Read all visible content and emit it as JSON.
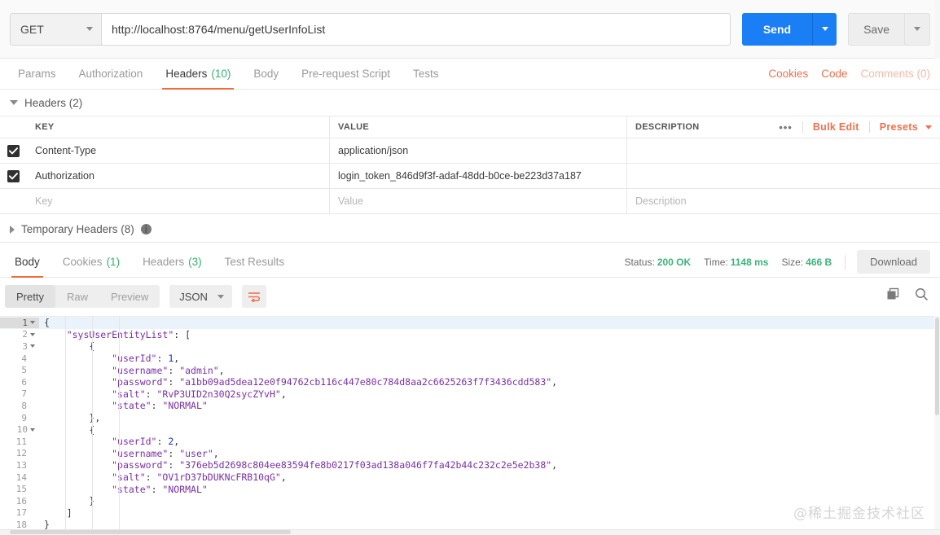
{
  "request": {
    "method": "GET",
    "url": "http://localhost:8764/menu/getUserInfoList",
    "send_label": "Send",
    "save_label": "Save",
    "tabs": [
      {
        "label": "Params",
        "count": "",
        "active": false
      },
      {
        "label": "Authorization",
        "count": "",
        "active": false
      },
      {
        "label": "Headers",
        "count": "(10)",
        "active": true
      },
      {
        "label": "Body",
        "count": "",
        "active": false
      },
      {
        "label": "Pre-request Script",
        "count": "",
        "active": false
      },
      {
        "label": "Tests",
        "count": "",
        "active": false
      }
    ],
    "links": {
      "cookies": "Cookies",
      "code": "Code",
      "comments": "Comments (0)"
    }
  },
  "headers_section": {
    "title": "Headers (2)",
    "columns": {
      "key": "KEY",
      "value": "VALUE",
      "description": "DESCRIPTION"
    },
    "tools": {
      "dots": "•••",
      "bulk_edit": "Bulk Edit",
      "presets": "Presets"
    },
    "rows": [
      {
        "checked": true,
        "key": "Content-Type",
        "value": "application/json",
        "description": ""
      },
      {
        "checked": true,
        "key": "Authorization",
        "value": "login_token_846d9f3f-adaf-48dd-b0ce-be223d37a187",
        "description": ""
      }
    ],
    "placeholder_row": {
      "key": "Key",
      "value": "Value",
      "description": "Description"
    },
    "temporary_headers": "Temporary Headers (8)",
    "info_glyph": "i"
  },
  "response": {
    "tabs": [
      {
        "label": "Body",
        "count": "",
        "active": true
      },
      {
        "label": "Cookies",
        "count": "(1)",
        "active": false
      },
      {
        "label": "Headers",
        "count": "(3)",
        "active": false
      },
      {
        "label": "Test Results",
        "count": "",
        "active": false
      }
    ],
    "status_label": "Status:",
    "status_value": "200 OK",
    "time_label": "Time:",
    "time_value": "1148 ms",
    "size_label": "Size:",
    "size_value": "466 B",
    "download_label": "Download",
    "view_modes": [
      {
        "label": "Pretty",
        "active": true
      },
      {
        "label": "Raw",
        "active": false
      },
      {
        "label": "Preview",
        "active": false
      }
    ],
    "format": "JSON"
  },
  "code": {
    "lines": [
      {
        "n": "1",
        "fold": true,
        "indent": 0,
        "tokens": [
          {
            "t": "{",
            "c": "k-brace"
          }
        ]
      },
      {
        "n": "2",
        "fold": true,
        "indent": 1,
        "tokens": [
          {
            "t": "\"sysUserEntityList\"",
            "c": "k-str"
          },
          {
            "t": ": [",
            "c": "k-pun"
          }
        ]
      },
      {
        "n": "3",
        "fold": true,
        "indent": 2,
        "tokens": [
          {
            "t": "{",
            "c": "k-brace"
          }
        ]
      },
      {
        "n": "4",
        "fold": false,
        "indent": 3,
        "tokens": [
          {
            "t": "\"userId\"",
            "c": "k-str"
          },
          {
            "t": ": ",
            "c": "k-pun"
          },
          {
            "t": "1",
            "c": "k-num"
          },
          {
            "t": ",",
            "c": "k-pun"
          }
        ]
      },
      {
        "n": "5",
        "fold": false,
        "indent": 3,
        "tokens": [
          {
            "t": "\"username\"",
            "c": "k-str"
          },
          {
            "t": ": ",
            "c": "k-pun"
          },
          {
            "t": "\"admin\"",
            "c": "k-str"
          },
          {
            "t": ",",
            "c": "k-pun"
          }
        ]
      },
      {
        "n": "6",
        "fold": false,
        "indent": 3,
        "tokens": [
          {
            "t": "\"password\"",
            "c": "k-str"
          },
          {
            "t": ": ",
            "c": "k-pun"
          },
          {
            "t": "\"a1bb09ad5dea12e0f94762cb116c447e80c784d8aa2c6625263f7f3436cdd583\"",
            "c": "k-str"
          },
          {
            "t": ",",
            "c": "k-pun"
          }
        ]
      },
      {
        "n": "7",
        "fold": false,
        "indent": 3,
        "tokens": [
          {
            "t": "\"salt\"",
            "c": "k-str"
          },
          {
            "t": ": ",
            "c": "k-pun"
          },
          {
            "t": "\"RvP3UID2n30Q2sycZYvH\"",
            "c": "k-str"
          },
          {
            "t": ",",
            "c": "k-pun"
          }
        ]
      },
      {
        "n": "8",
        "fold": false,
        "indent": 3,
        "tokens": [
          {
            "t": "\"state\"",
            "c": "k-str"
          },
          {
            "t": ": ",
            "c": "k-pun"
          },
          {
            "t": "\"NORMAL\"",
            "c": "k-str"
          }
        ]
      },
      {
        "n": "9",
        "fold": false,
        "indent": 2,
        "tokens": [
          {
            "t": "},",
            "c": "k-brace"
          }
        ]
      },
      {
        "n": "10",
        "fold": true,
        "indent": 2,
        "tokens": [
          {
            "t": "{",
            "c": "k-brace"
          }
        ]
      },
      {
        "n": "11",
        "fold": false,
        "indent": 3,
        "tokens": [
          {
            "t": "\"userId\"",
            "c": "k-str"
          },
          {
            "t": ": ",
            "c": "k-pun"
          },
          {
            "t": "2",
            "c": "k-num"
          },
          {
            "t": ",",
            "c": "k-pun"
          }
        ]
      },
      {
        "n": "12",
        "fold": false,
        "indent": 3,
        "tokens": [
          {
            "t": "\"username\"",
            "c": "k-str"
          },
          {
            "t": ": ",
            "c": "k-pun"
          },
          {
            "t": "\"user\"",
            "c": "k-str"
          },
          {
            "t": ",",
            "c": "k-pun"
          }
        ]
      },
      {
        "n": "13",
        "fold": false,
        "indent": 3,
        "tokens": [
          {
            "t": "\"password\"",
            "c": "k-str"
          },
          {
            "t": ": ",
            "c": "k-pun"
          },
          {
            "t": "\"376eb5d2698c804ee83594fe8b0217f03ad138a046f7fa42b44c232c2e5e2b38\"",
            "c": "k-str"
          },
          {
            "t": ",",
            "c": "k-pun"
          }
        ]
      },
      {
        "n": "14",
        "fold": false,
        "indent": 3,
        "tokens": [
          {
            "t": "\"salt\"",
            "c": "k-str"
          },
          {
            "t": ": ",
            "c": "k-pun"
          },
          {
            "t": "\"OV1rD37bDUKNcFRB10qG\"",
            "c": "k-str"
          },
          {
            "t": ",",
            "c": "k-pun"
          }
        ]
      },
      {
        "n": "15",
        "fold": false,
        "indent": 3,
        "tokens": [
          {
            "t": "\"state\"",
            "c": "k-str"
          },
          {
            "t": ": ",
            "c": "k-pun"
          },
          {
            "t": "\"NORMAL\"",
            "c": "k-str"
          }
        ]
      },
      {
        "n": "16",
        "fold": false,
        "indent": 2,
        "tokens": [
          {
            "t": "}",
            "c": "k-brace"
          }
        ]
      },
      {
        "n": "17",
        "fold": false,
        "indent": 1,
        "tokens": [
          {
            "t": "]",
            "c": "k-pun"
          }
        ]
      },
      {
        "n": "18",
        "fold": false,
        "indent": 0,
        "tokens": [
          {
            "t": "}",
            "c": "k-brace"
          }
        ]
      }
    ]
  },
  "watermark": "@稀土掘金技术社区",
  "colors": {
    "accent_orange": "#f2704f",
    "send_blue": "#1a7ef4",
    "status_green": "#3ab37a",
    "count_green": "#33b26e",
    "json_string": "#7b2fa8",
    "json_number": "#1a2fd0"
  }
}
